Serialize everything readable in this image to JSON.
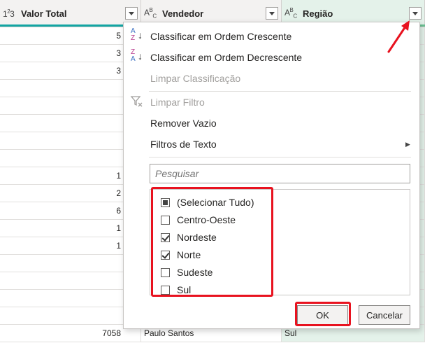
{
  "columns": [
    {
      "type": "123",
      "title": "Valor Total"
    },
    {
      "type": "ABC",
      "title": "Vendedor"
    },
    {
      "type": "ABC",
      "title": "Região"
    }
  ],
  "rows": [
    {
      "valor": "5",
      "vendedor": "",
      "regiao": ""
    },
    {
      "valor": "3",
      "vendedor": "",
      "regiao": ""
    },
    {
      "valor": "3",
      "vendedor": "",
      "regiao": ""
    },
    {
      "valor": "",
      "vendedor": "",
      "regiao": ""
    },
    {
      "valor": "",
      "vendedor": "",
      "regiao": ""
    },
    {
      "valor": "",
      "vendedor": "",
      "regiao": ""
    },
    {
      "valor": "",
      "vendedor": "",
      "regiao": ""
    },
    {
      "valor": "",
      "vendedor": "",
      "regiao": ""
    },
    {
      "valor": "1",
      "vendedor": "",
      "regiao": ""
    },
    {
      "valor": "2",
      "vendedor": "",
      "regiao": ""
    },
    {
      "valor": "6",
      "vendedor": "",
      "regiao": ""
    },
    {
      "valor": "1",
      "vendedor": "",
      "regiao": ""
    },
    {
      "valor": "1",
      "vendedor": "",
      "regiao": ""
    },
    {
      "valor": "",
      "vendedor": "",
      "regiao": ""
    },
    {
      "valor": "",
      "vendedor": "",
      "regiao": ""
    },
    {
      "valor": "",
      "vendedor": "",
      "regiao": ""
    },
    {
      "valor": "",
      "vendedor": "",
      "regiao": ""
    },
    {
      "valor": "7058",
      "vendedor": "Paulo Santos",
      "regiao": "Sul"
    }
  ],
  "menu": {
    "sort_asc": "Classificar em Ordem Crescente",
    "sort_desc": "Classificar em Ordem Decrescente",
    "clear_sort": "Limpar Classificação",
    "clear_filter": "Limpar Filtro",
    "remove_empty": "Remover Vazio",
    "text_filters": "Filtros de Texto"
  },
  "search": {
    "placeholder": "Pesquisar"
  },
  "options": [
    {
      "label": "(Selecionar Tudo)",
      "state": "partial"
    },
    {
      "label": "Centro-Oeste",
      "state": "unchecked"
    },
    {
      "label": "Nordeste",
      "state": "checked"
    },
    {
      "label": "Norte",
      "state": "checked"
    },
    {
      "label": "Sudeste",
      "state": "unchecked"
    },
    {
      "label": "Sul",
      "state": "unchecked"
    }
  ],
  "buttons": {
    "ok": "OK",
    "cancel": "Cancelar"
  },
  "colors": {
    "accent": "#12a5a3",
    "highlight": "#e8121f",
    "selected_column": "#e4f2ea"
  }
}
